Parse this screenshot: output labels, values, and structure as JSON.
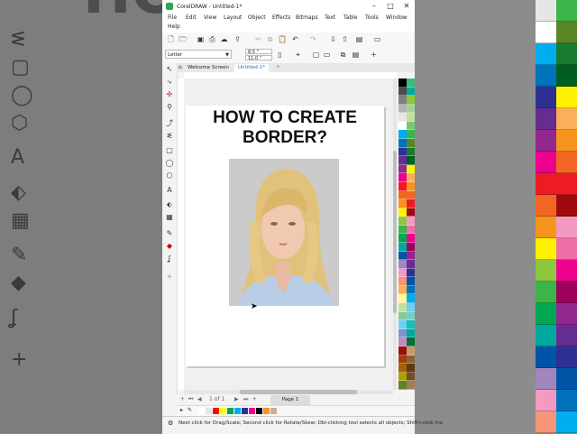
{
  "window": {
    "title": "CorelDRAW - Untitled-1*",
    "minimize": "–",
    "maximize": "□",
    "close": "✕"
  },
  "menu": [
    "File",
    "Edit",
    "View",
    "Layout",
    "Object",
    "Effects",
    "Bitmaps",
    "Text",
    "Table",
    "Tools",
    "Window",
    "Help"
  ],
  "property_bar": {
    "paper_size": "Letter",
    "width": "8.5 \"",
    "height": "11.0 \""
  },
  "tabs": [
    "Welcome Screen",
    "Untitled-1*"
  ],
  "page": {
    "headline_line1": "HOW TO CREATE",
    "headline_line2": "BORDER?"
  },
  "page_nav": {
    "count": "1 of 1",
    "tab_label": "Page 1"
  },
  "status_bar": {
    "hint": "Next click for Drag/Scale; Second click for Rotate/Skew; Dbl-clicking tool selects all objects; Shift+click mu"
  },
  "background": {
    "ghost_title": "HOW TO CREATE"
  },
  "colors": {
    "doc_palette": [
      "#ffffff",
      "#e6e6e6",
      "#ff0000",
      "#ffff00",
      "#00a651",
      "#00aeef",
      "#2e3192",
      "#ec008c",
      "#000000",
      "#f7941d",
      "#c7b299"
    ],
    "color_palette_col1": [
      "#000000",
      "#4d4d4d",
      "#808080",
      "#b3b3b3",
      "#e6e6e6",
      "#ffffff",
      "#00aeef",
      "#0072bc",
      "#2e3192",
      "#662d91",
      "#92278f",
      "#ec008c",
      "#ed1c24",
      "#f26522",
      "#f7941d",
      "#fff200",
      "#8dc63f",
      "#39b54a",
      "#00a651",
      "#00a99d",
      "#0054a6",
      "#a186be",
      "#f49ac1",
      "#f69679",
      "#fbaf5d",
      "#fff799",
      "#c4df9b",
      "#82ca9c",
      "#6dcff6",
      "#8393ca",
      "#bd8cbf",
      "#9e0b0f",
      "#a0410d",
      "#a3620a",
      "#aba000",
      "#598527"
    ],
    "color_palette_col2": [
      "#3cb878",
      "#00a99d",
      "#8dc63f",
      "#a3d39c",
      "#c4df9b",
      "#7cc576",
      "#39b54a",
      "#598527",
      "#197b30",
      "#005e20",
      "#fff200",
      "#fbaf5d",
      "#f7941d",
      "#f26522",
      "#ed1c24",
      "#9e0b0f",
      "#f49ac1",
      "#f06eaa",
      "#ec008c",
      "#9e005d",
      "#92278f",
      "#662d91",
      "#2e3192",
      "#0054a6",
      "#0072bc",
      "#00aeef",
      "#6dcff6",
      "#7accc8",
      "#1cbbb4",
      "#00a99d",
      "#007236",
      "#c69c6d",
      "#8c6239",
      "#603913",
      "#754c24",
      "#a67c52"
    ]
  }
}
